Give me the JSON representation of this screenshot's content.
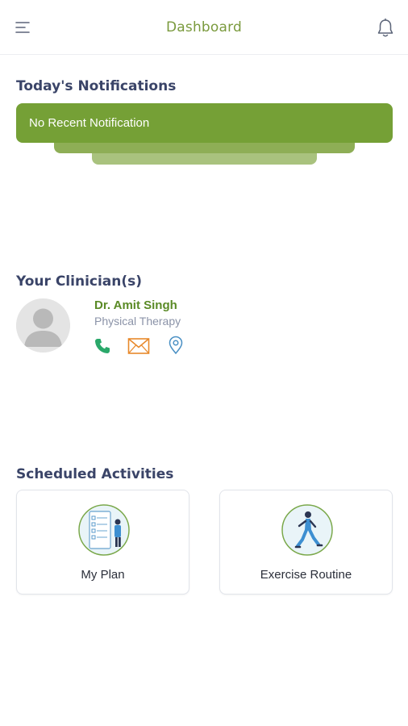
{
  "header": {
    "title": "Dashboard",
    "menu_icon": "menu-icon",
    "notification_icon": "bell-icon"
  },
  "notifications": {
    "section_title": "Today's Notifications",
    "message": "No Recent Notification"
  },
  "clinicians": {
    "section_title": "Your Clinician(s)",
    "items": [
      {
        "name": "Dr. Amit Singh",
        "specialty": "Physical Therapy",
        "actions": [
          "phone-icon",
          "mail-icon",
          "location-icon"
        ]
      }
    ]
  },
  "activities": {
    "section_title": "Scheduled Activities",
    "items": [
      {
        "label": "My Plan",
        "icon": "plan-checklist-icon"
      },
      {
        "label": "Exercise Routine",
        "icon": "running-person-icon"
      }
    ]
  },
  "colors": {
    "accent_green": "#75a036",
    "title_green": "#7a9a3d",
    "heading_navy": "#3a4468",
    "phone_green": "#2aa86a",
    "mail_orange": "#e8892b",
    "location_blue": "#4a90c4"
  }
}
